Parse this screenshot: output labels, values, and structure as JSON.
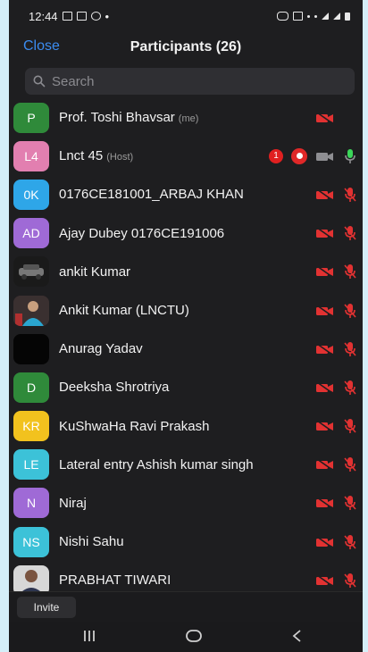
{
  "status": {
    "time": "12:44",
    "bullet": "•"
  },
  "header": {
    "close_label": "Close",
    "title": "Participants (26)"
  },
  "search": {
    "placeholder": "Search"
  },
  "participants": [
    {
      "name": "Prof. Toshi Bhavsar",
      "tag": "(me)",
      "initials": "P",
      "color": "#2f8a3a",
      "icon": "initials",
      "video": "off",
      "audio": "none"
    },
    {
      "name": "Lnct 45",
      "tag": "(Host)",
      "initials": "L4",
      "color": "#e27fb0",
      "icon": "initials",
      "video": "on",
      "audio": "on",
      "badge": "1",
      "recording": true
    },
    {
      "name": "0176CE181001_ARBAJ KHAN",
      "tag": "",
      "initials": "0K",
      "color": "#2ea6e8",
      "icon": "initials",
      "video": "off",
      "audio": "muted"
    },
    {
      "name": "Ajay Dubey 0176CE191006",
      "tag": "",
      "initials": "AD",
      "color": "#9f6ad6",
      "icon": "initials",
      "video": "off",
      "audio": "muted"
    },
    {
      "name": "ankit Kumar",
      "tag": "",
      "initials": "",
      "color": "#222",
      "icon": "photo-car",
      "video": "off",
      "audio": "muted"
    },
    {
      "name": "Ankit Kumar (LNCTU)",
      "tag": "",
      "initials": "",
      "color": "#3a2a2a",
      "icon": "photo-person",
      "video": "off",
      "audio": "muted"
    },
    {
      "name": "Anurag Yadav",
      "tag": "",
      "initials": "",
      "color": "#050505",
      "icon": "blank",
      "video": "off",
      "audio": "muted"
    },
    {
      "name": "Deeksha Shrotriya",
      "tag": "",
      "initials": "D",
      "color": "#2f8a3a",
      "icon": "initials",
      "video": "off",
      "audio": "muted"
    },
    {
      "name": "KuShwaHa Ravi Prakash",
      "tag": "",
      "initials": "KR",
      "color": "#f2c21e",
      "icon": "initials",
      "video": "off",
      "audio": "muted"
    },
    {
      "name": "Lateral entry Ashish kumar singh",
      "tag": "",
      "initials": "LE",
      "color": "#3cc2d8",
      "icon": "initials",
      "video": "off",
      "audio": "muted"
    },
    {
      "name": "Niraj",
      "tag": "",
      "initials": "N",
      "color": "#9f6ad6",
      "icon": "initials",
      "video": "off",
      "audio": "muted"
    },
    {
      "name": "Nishi Sahu",
      "tag": "",
      "initials": "NS",
      "color": "#3cc2d8",
      "icon": "initials",
      "video": "off",
      "audio": "muted"
    },
    {
      "name": "PRABHAT TIWARI",
      "tag": "",
      "initials": "",
      "color": "#2a2a30",
      "icon": "photo-person2",
      "video": "off",
      "audio": "muted"
    }
  ],
  "footer": {
    "invite_label": "Invite"
  },
  "colors": {
    "accent": "#3b8cf0",
    "muted_red": "#e23232",
    "mic_green": "#3bd65a"
  }
}
